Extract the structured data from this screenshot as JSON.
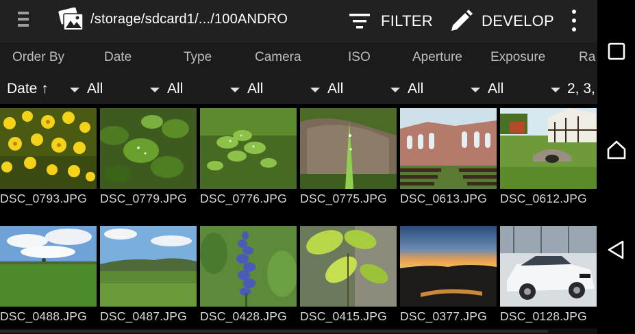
{
  "toolbar": {
    "menu_icon": "hamburger-menu-icon",
    "logo_icon": "photo-stack-logo-icon",
    "path": "/storage/sdcard1/.../100ANDRO",
    "filter_label": "FILTER",
    "filter_icon": "filter-lines-icon",
    "develop_label": "DEVELOP",
    "develop_icon": "pencil-icon",
    "overflow_icon": "more-vertical-icon"
  },
  "columns": {
    "headers": [
      "Order By",
      "Date",
      "Type",
      "Camera",
      "ISO",
      "Aperture",
      "Exposure",
      "Ra"
    ],
    "filters": [
      "Date ↑",
      "All",
      "All",
      "All",
      "All",
      "All",
      "All",
      "2, 3,"
    ]
  },
  "photos": [
    {
      "name": "DSC_0793.JPG",
      "subject": "yellow wildflowers"
    },
    {
      "name": "DSC_0779.JPG",
      "subject": "leaves with water drops"
    },
    {
      "name": "DSC_0776.JPG",
      "subject": "clover with water drops"
    },
    {
      "name": "DSC_0775.JPG",
      "subject": "grass blade and rock"
    },
    {
      "name": "DSC_0613.JPG",
      "subject": "abbey ruins with benches"
    },
    {
      "name": "DSC_0612.JPG",
      "subject": "half-timbered house and bridge"
    },
    {
      "name": "DSC_0488.JPG",
      "subject": "green field and sky"
    },
    {
      "name": "DSC_0487.JPG",
      "subject": "landscape with hills"
    },
    {
      "name": "DSC_0428.JPG",
      "subject": "blue bugle flower"
    },
    {
      "name": "DSC_0415.JPG",
      "subject": "beech leaves"
    },
    {
      "name": "DSC_0377.JPG",
      "subject": "sunset"
    },
    {
      "name": "DSC_0128.JPG",
      "subject": "white car in showroom"
    }
  ],
  "navbar": {
    "recents_icon": "recents-square-icon",
    "home_icon": "home-icon",
    "back_icon": "back-triangle-icon"
  },
  "colors": {
    "toolbar_bg": "#212121",
    "header_bg": "#1b1b1b",
    "background": "#000000"
  }
}
